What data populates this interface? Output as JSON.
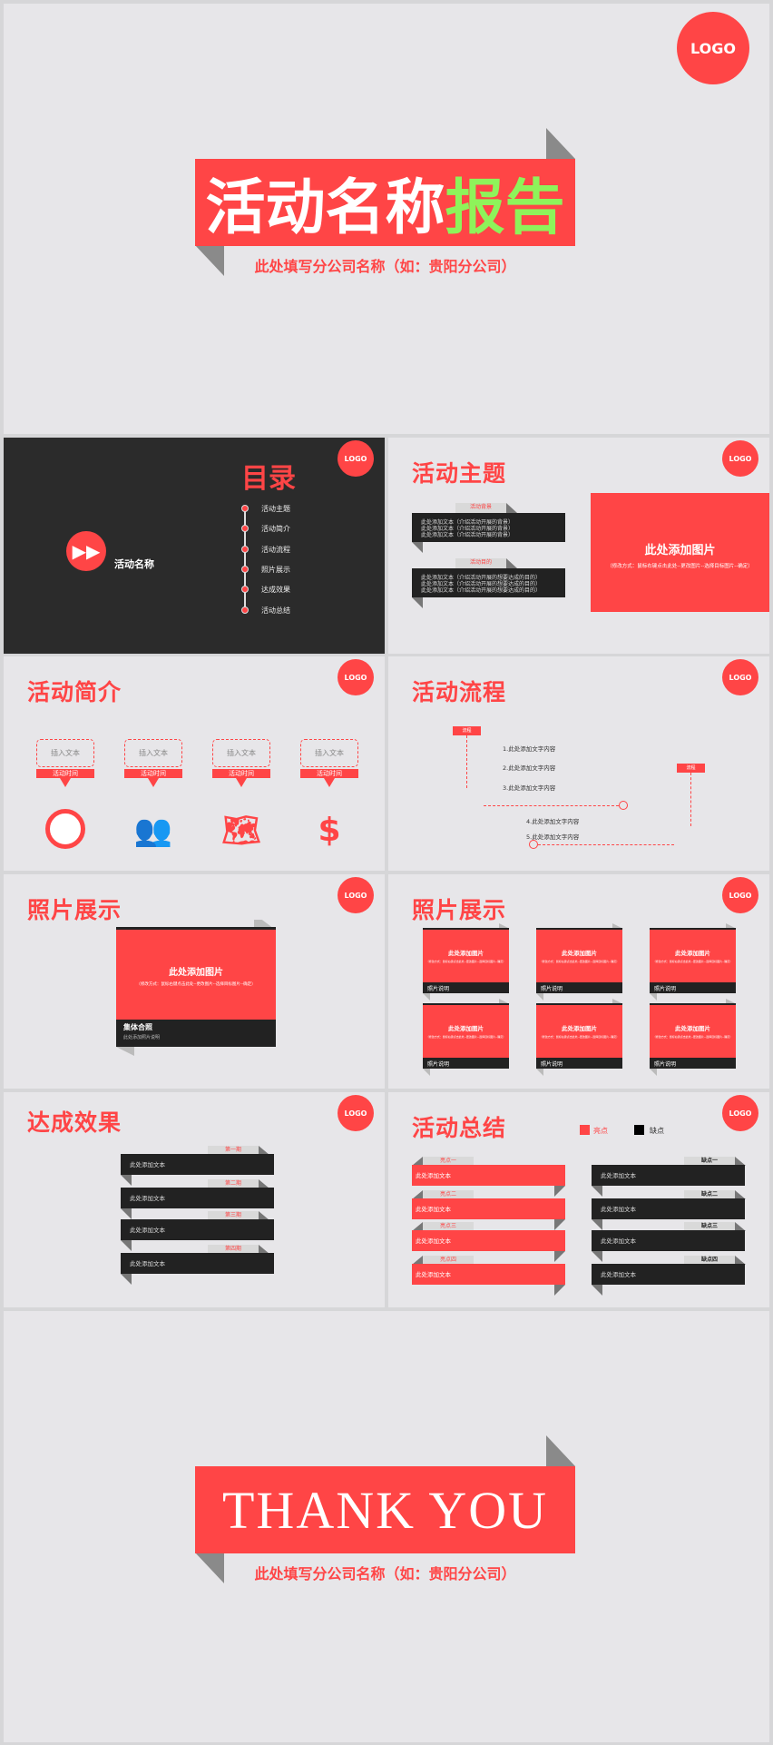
{
  "colors": {
    "accent": "#ff4546",
    "highlight": "#8ef35a",
    "dark": "#2b2b2b",
    "background": "#e7e6e9"
  },
  "logo": "LOGO",
  "cover": {
    "title_main": "活动名称",
    "title_accent": "报告",
    "subtitle": "此处填写分公司名称（如：贵阳分公司）"
  },
  "toc": {
    "title": "目录",
    "activity_name": "活动名称",
    "icon": "fast-forward-icon",
    "items": [
      "活动主题",
      "活动简介",
      "活动流程",
      "照片展示",
      "达成效果",
      "活动总结"
    ]
  },
  "theme": {
    "title": "活动主题",
    "blocks": [
      {
        "tag": "活动背景",
        "lines": [
          "此处添加文本（介绍活动开展的背景）",
          "此处添加文本（介绍活动开展的背景）",
          "此处添加文本（介绍活动开展的背景）"
        ]
      },
      {
        "tag": "活动目的",
        "lines": [
          "此处添加文本（介绍活动开展的想要达成的目的）",
          "此处添加文本（介绍活动开展的想要达成的目的）",
          "此处添加文本（介绍活动开展的想要达成的目的）"
        ]
      }
    ],
    "image_title": "此处添加图片",
    "image_hint": "（修改方式：鼠标右键点击此处--更改图片--选择目标图片--确定）"
  },
  "intro": {
    "title": "活动简介",
    "items": [
      {
        "text": "插入文本",
        "label": "活动时间",
        "icon": "clock-icon"
      },
      {
        "text": "插入文本",
        "label": "活动时间",
        "icon": "people-icon"
      },
      {
        "text": "插入文本",
        "label": "活动时间",
        "icon": "china-map-icon"
      },
      {
        "text": "插入文本",
        "label": "活动时间",
        "icon": "dollar-icon"
      }
    ]
  },
  "process": {
    "title": "活动流程",
    "tag1": "流程",
    "tag2": "流程",
    "steps": [
      "1.此处添加文字内容",
      "2.此处添加文字内容",
      "3.此处添加文字内容",
      "4.此处添加文字内容",
      "5.此处添加文字内容"
    ]
  },
  "photo1": {
    "title": "照片展示",
    "image_title": "此处添加图片",
    "image_hint": "（修改方式：鼠标右键点击此处--更改图片--选择目标图片--确定）",
    "caption": "集体合照",
    "caption_sub": "此处添加照片说明"
  },
  "photo2": {
    "title": "照片展示",
    "items": [
      {
        "image_title": "此处添加图片",
        "hint": "（修改方式：鼠标右键点击此处--更改图片--选择目标图片--确定）",
        "caption": "照片说明"
      },
      {
        "image_title": "此处添加图片",
        "hint": "（修改方式：鼠标右键点击此处--更改图片--选择目标图片--确定）",
        "caption": "照片说明"
      },
      {
        "image_title": "此处添加图片",
        "hint": "（修改方式：鼠标右键点击此处--更改图片--选择目标图片--确定）",
        "caption": "照片说明"
      },
      {
        "image_title": "此处添加图片",
        "hint": "（修改方式：鼠标右键点击此处--更改图片--选择目标图片--确定）",
        "caption": "照片说明"
      },
      {
        "image_title": "此处添加图片",
        "hint": "（修改方式：鼠标右键点击此处--更改图片--选择目标图片--确定）",
        "caption": "照片说明"
      },
      {
        "image_title": "此处添加图片",
        "hint": "（修改方式：鼠标右键点击此处--更改图片--选择目标图片--确定）",
        "caption": "照片说明"
      }
    ]
  },
  "results": {
    "title": "达成效果",
    "items": [
      {
        "tag": "第一期",
        "text": "此处添加文本"
      },
      {
        "tag": "第二期",
        "text": "此处添加文本"
      },
      {
        "tag": "第三期",
        "text": "此处添加文本"
      },
      {
        "tag": "第四期",
        "text": "此处添加文本"
      }
    ]
  },
  "summary": {
    "title": "活动总结",
    "legend_pro": "亮点",
    "legend_con": "缺点",
    "pros": [
      {
        "tag": "亮点一",
        "text": "此处添加文本"
      },
      {
        "tag": "亮点二",
        "text": "此处添加文本"
      },
      {
        "tag": "亮点三",
        "text": "此处添加文本"
      },
      {
        "tag": "亮点四",
        "text": "此处添加文本"
      }
    ],
    "cons": [
      {
        "tag": "缺点一",
        "text": "此处添加文本"
      },
      {
        "tag": "缺点二",
        "text": "此处添加文本"
      },
      {
        "tag": "缺点三",
        "text": "此处添加文本"
      },
      {
        "tag": "缺点四",
        "text": "此处添加文本"
      }
    ]
  },
  "ending": {
    "title": "THANK YOU",
    "subtitle": "此处填写分公司名称（如：贵阳分公司）"
  }
}
